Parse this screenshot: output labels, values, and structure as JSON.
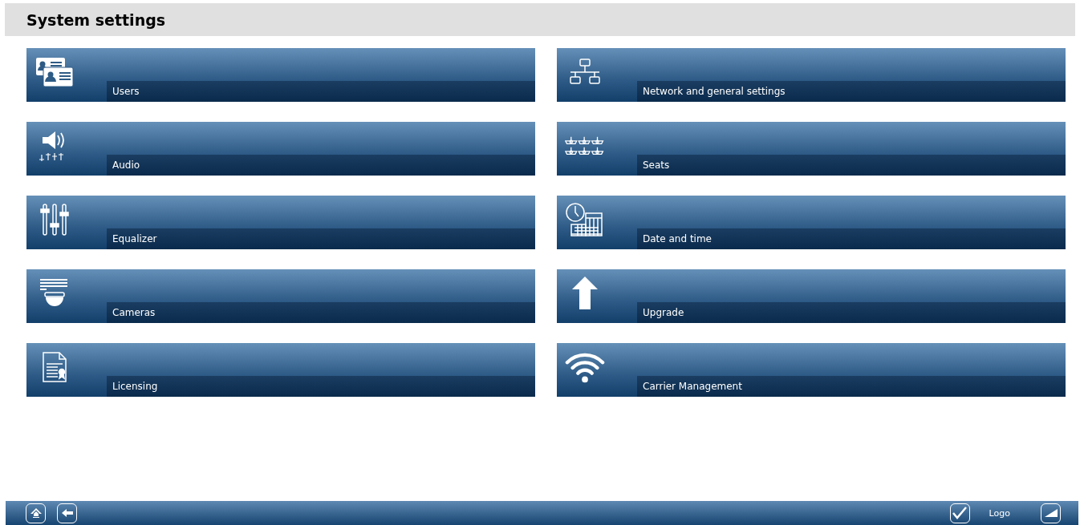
{
  "title": "System settings",
  "tiles": [
    {
      "label": "Users",
      "kind": "users"
    },
    {
      "label": "Network and general settings",
      "kind": "network"
    },
    {
      "label": "Audio",
      "kind": "audio"
    },
    {
      "label": "Seats",
      "kind": "seats"
    },
    {
      "label": "Equalizer",
      "kind": "equalizer"
    },
    {
      "label": "Date and time",
      "kind": "datetime"
    },
    {
      "label": "Cameras",
      "kind": "camera"
    },
    {
      "label": "Upgrade",
      "kind": "upgrade"
    },
    {
      "label": "Licensing",
      "kind": "license"
    },
    {
      "label": "Carrier Management",
      "kind": "wifi"
    }
  ],
  "footer": {
    "left_buttons": [
      {
        "kind": "home"
      },
      {
        "kind": "back"
      }
    ],
    "right": [
      {
        "kind": "check"
      },
      {
        "kind": "logo",
        "label": "Logo"
      },
      {
        "kind": "volume"
      }
    ]
  }
}
